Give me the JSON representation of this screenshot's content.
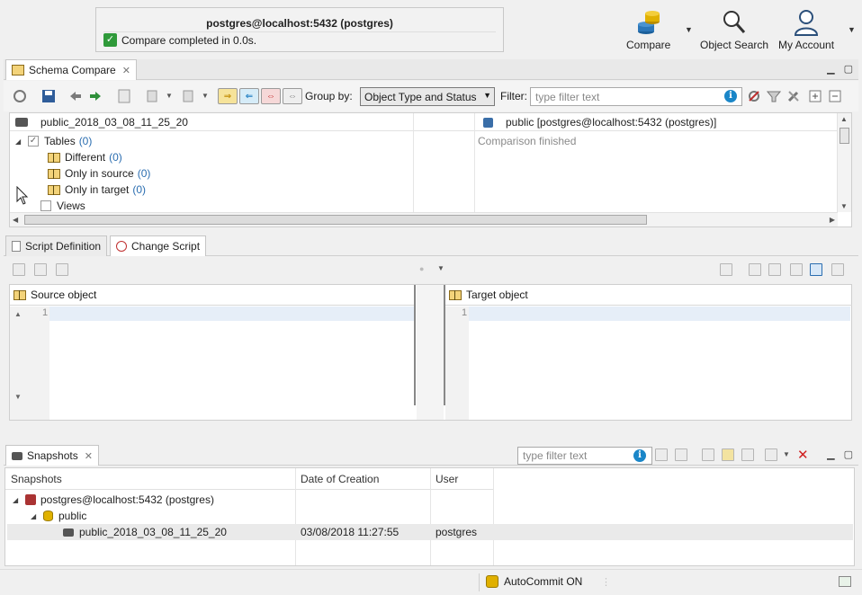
{
  "notification": {
    "connection": "postgres@localhost:5432 (postgres)",
    "message": "Compare completed in 0.0s."
  },
  "toolbar_top": {
    "compare_label": "Compare",
    "object_search_label": "Object Search",
    "my_account_label": "My Account"
  },
  "schema_compare": {
    "tab_label": "Schema Compare",
    "group_by_label": "Group by:",
    "group_by_value": "Object Type and Status",
    "filter_label": "Filter:",
    "filter_placeholder": "type filter text",
    "source_snapshot": "public_2018_03_08_11_25_20",
    "target_label": "public [postgres@localhost:5432 (postgres)]",
    "status": "Comparison finished",
    "tree": [
      {
        "label": "Tables",
        "count": "(0)"
      },
      {
        "label": "Different",
        "count": "(0)"
      },
      {
        "label": "Only in source",
        "count": "(0)"
      },
      {
        "label": "Only in target",
        "count": "(0)"
      },
      {
        "label": "Views",
        "count": ""
      }
    ]
  },
  "script_panel": {
    "tabs": [
      "Script Definition",
      "Change Script"
    ],
    "source_header": "Source object",
    "target_header": "Target object",
    "source_line": "1",
    "target_line": "1"
  },
  "snapshots": {
    "tab_label": "Snapshots",
    "filter_placeholder": "type filter text",
    "columns": [
      "Snapshots",
      "Date of Creation",
      "User"
    ],
    "rows": [
      {
        "name": "postgres@localhost:5432 (postgres)",
        "date": "",
        "user": ""
      },
      {
        "name": "public",
        "date": "",
        "user": ""
      },
      {
        "name": "public_2018_03_08_11_25_20",
        "date": "03/08/2018 11:27:55",
        "user": "postgres"
      }
    ]
  },
  "statusbar": {
    "autocommit": "AutoCommit ON"
  }
}
